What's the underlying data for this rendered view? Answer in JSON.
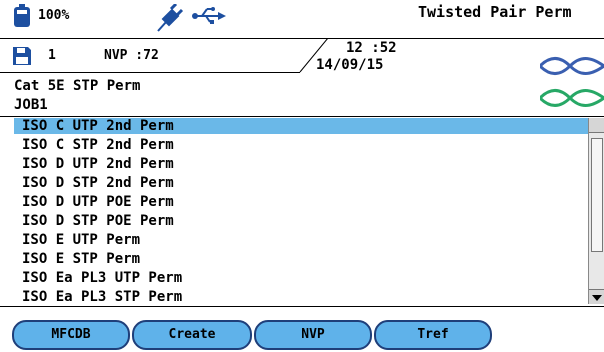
{
  "status": {
    "battery": "100%",
    "title": "Twisted Pair Perm",
    "disk_number": "1",
    "nvp": "NVP :72",
    "time": "12 :52",
    "date": "14/09/15"
  },
  "cable": {
    "type": "Cat 5E STP Perm",
    "job": "JOB1"
  },
  "list": {
    "items": [
      "ISO C UTP 2nd Perm",
      "ISO C STP 2nd Perm",
      "ISO D UTP 2nd Perm",
      "ISO D STP 2nd Perm",
      "ISO D UTP POE Perm",
      "ISO D STP POE Perm",
      "ISO E UTP Perm",
      "ISO E STP Perm",
      "ISO Ea PL3 UTP Perm",
      "ISO Ea PL3 STP Perm"
    ],
    "selected_index": 0
  },
  "tabs": [
    "MFCDB",
    "Create",
    "NVP",
    "Tref"
  ],
  "colors": {
    "selection": "#6ab8e8",
    "tab": "#5fb2ea",
    "icon_blue": "#1d4fa0",
    "cable_blue": "#3a5fb0",
    "cable_green": "#27a866"
  },
  "icons": [
    "battery-icon",
    "plug-icon",
    "usb-icon",
    "disk-icon",
    "cable-icon"
  ]
}
